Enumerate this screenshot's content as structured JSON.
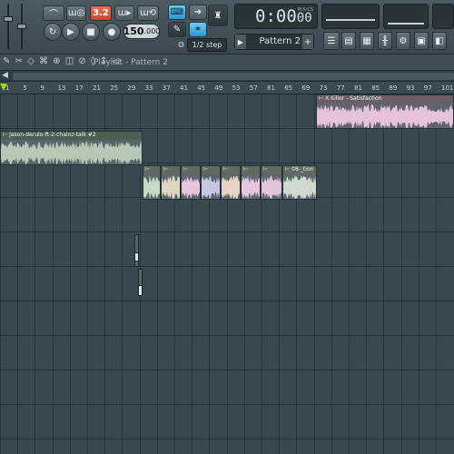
{
  "toolbar": {
    "transport": {
      "play_icon": "play-icon",
      "stop_icon": "stop-icon",
      "record_icon": "record-icon",
      "loop_icon": "loop-icon"
    },
    "pattern_song_label": "3.2",
    "tempo": {
      "value": "150",
      "decimals": ".000"
    },
    "time": {
      "display": "0:00",
      "sub": "00",
      "unit": "M:S:CS"
    },
    "pattern_selector": {
      "label": "Pattern 2"
    },
    "snap": {
      "label": "1/2 step"
    }
  },
  "playlist": {
    "title": "Playlist - Pattern 2",
    "ruler_ticks": [
      "1",
      "5",
      "9",
      "13",
      "17",
      "21",
      "25",
      "29",
      "33",
      "37",
      "41",
      "45",
      "49",
      "53",
      "57",
      "61",
      "65",
      "69",
      "73",
      "77",
      "81",
      "85",
      "89",
      "93",
      "97",
      "101"
    ]
  },
  "clips": [
    {
      "label": "X Killer - Satisfaction",
      "color": "#e7c2dc"
    },
    {
      "label": "jason-derulo-ft-2-chainz-talk #2",
      "color": "#b7c9b6"
    },
    {
      "label": "",
      "color": "#c7dac6"
    },
    {
      "label": "",
      "color": "#ddd6c0"
    },
    {
      "label": "",
      "color": "#e7c6dd"
    },
    {
      "label": "",
      "color": "#c7c6e0"
    },
    {
      "label": "",
      "color": "#e9d3c6"
    },
    {
      "label": "",
      "color": "#e6c7df"
    },
    {
      "label": "",
      "color": "#e2c4dd"
    },
    {
      "label": "08-_tion",
      "color": "#cfd9cf"
    }
  ]
}
